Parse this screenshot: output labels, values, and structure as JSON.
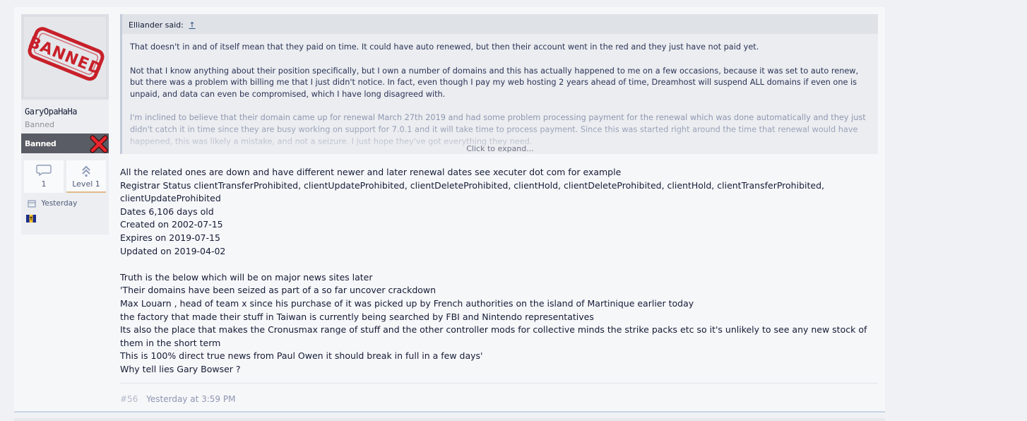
{
  "user": {
    "avatar_text": "BANNED",
    "name": "GaryOpaHaHa",
    "title": "Banned",
    "banner": "Banned",
    "messages_count": "1",
    "level": "Level 1",
    "joined": "Yesterday",
    "icons": {
      "messages": "speech-bubble-icon",
      "level": "double-chevron-up-icon",
      "joined": "calendar-icon",
      "banner": "red-x-icon",
      "flag": "flag-icon"
    }
  },
  "quote": {
    "author_label": "Elliander said:",
    "jump_arrow": "↑",
    "paragraphs": [
      "That doesn't in and of itself mean that they paid on time. It could have auto renewed, but then their account went in the red and they just have not paid yet.",
      "Not that I know anything about their position specifically, but I own a number of domains and this has actually happened to me on a few occasions, because it was set to auto renew, but there was a problem with billing me that I just didn't notice. In fact, even though I pay my web hosting 2 years ahead of time, Dreamhost will suspend ALL domains if even one is unpaid, and data can even be compromised, which I have long disagreed with.",
      "I'm inclined to believe that their domain came up for renewal March 27th 2019 and had some problem processing payment for the renewal which was done automatically and they just didn't catch it in time since they are busy working on support for 7.0.1 and it will take time to process payment. Since this was started right around the time that renewal would have happened, this was likely a mistake, and not a seizure. I just hope they've got everything they need."
    ],
    "expand_label": "Click to expand..."
  },
  "message": {
    "block1": [
      "All the related ones are down and have different newer and later renewal dates see xecuter dot com for example",
      "Registrar Status clientTransferProhibited, clientUpdateProhibited, clientDeleteProhibited, clientHold, clientDeleteProhibited, clientHold, clientTransferProhibited, clientUpdateProhibited",
      "Dates 6,106 days old",
      "Created on 2002-07-15",
      "Expires on 2019-07-15",
      "Updated on 2019-04-02"
    ],
    "block2": [
      "Truth is the below which will be on major news sites later",
      "'Their domains have been seized as part of a so far uncover crackdown",
      "Max Louarn , head of team x since his purchase of it was picked up by French authorities on the island of Martinique earlier today",
      "the factory that made their stuff in Taiwan is currently being searched by FBI and Nintendo representatives",
      "Its also the place that makes the Cronusmax range of stuff and the other controller mods for collective minds the strike packs etc so it's unlikely to see any new stock of them in the short term",
      "This is 100% direct true news from Paul Owen it should break in full in a few days'",
      "Why tell lies Gary Bowser ?"
    ]
  },
  "post_meta": {
    "number": "#56",
    "date": "Yesterday at 3:59 PM"
  },
  "colors": {
    "banner_bg": "#595c64",
    "stamp_red": "#c8202a",
    "link": "#2e4f86",
    "level_underline": "#e1b98a"
  }
}
